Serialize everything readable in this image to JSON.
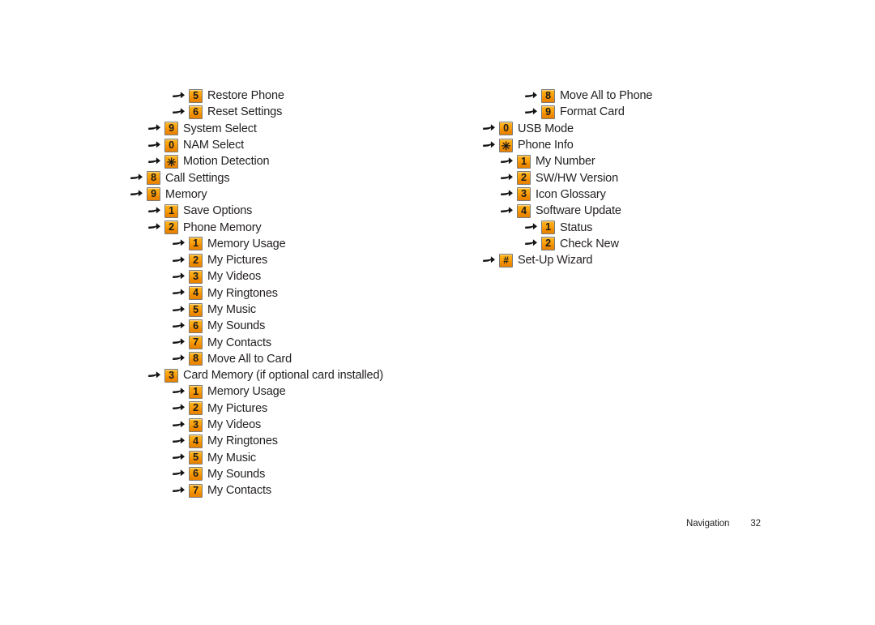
{
  "document": {
    "footer": {
      "section_label": "Navigation",
      "page_number": "32"
    }
  },
  "icons": {
    "arrow": "right-arrow-icon"
  },
  "colors": {
    "badge_top": "#ffb61e",
    "badge_bottom": "#e78200",
    "badge_border": "#7b7b7b",
    "text": "#231f20",
    "page_background": "#ffffff"
  },
  "menu": {
    "left_column": [
      {
        "level": 2,
        "key": "5",
        "label": "Restore Phone"
      },
      {
        "level": 2,
        "key": "6",
        "label": "Reset Settings"
      },
      {
        "level": 1,
        "key": "9",
        "label": "System Select"
      },
      {
        "level": 1,
        "key": "0",
        "label": "NAM Select"
      },
      {
        "level": 1,
        "key": "✳",
        "label": "Motion Detection"
      },
      {
        "level": 0,
        "key": "8",
        "label": "Call Settings"
      },
      {
        "level": 0,
        "key": "9",
        "label": "Memory"
      },
      {
        "level": 1,
        "key": "1",
        "label": "Save Options"
      },
      {
        "level": 1,
        "key": "2",
        "label": "Phone Memory"
      },
      {
        "level": 2,
        "key": "1",
        "label": "Memory Usage"
      },
      {
        "level": 2,
        "key": "2",
        "label": "My Pictures"
      },
      {
        "level": 2,
        "key": "3",
        "label": "My Videos"
      },
      {
        "level": 2,
        "key": "4",
        "label": "My Ringtones"
      },
      {
        "level": 2,
        "key": "5",
        "label": "My Music"
      },
      {
        "level": 2,
        "key": "6",
        "label": "My Sounds"
      },
      {
        "level": 2,
        "key": "7",
        "label": "My Contacts"
      },
      {
        "level": 2,
        "key": "8",
        "label": "Move All to Card"
      },
      {
        "level": 1,
        "key": "3",
        "label": "Card Memory (if optional card installed)"
      },
      {
        "level": 2,
        "key": "1",
        "label": "Memory Usage"
      },
      {
        "level": 2,
        "key": "2",
        "label": "My Pictures"
      },
      {
        "level": 2,
        "key": "3",
        "label": "My Videos"
      },
      {
        "level": 2,
        "key": "4",
        "label": "My Ringtones"
      },
      {
        "level": 2,
        "key": "5",
        "label": "My Music"
      },
      {
        "level": 2,
        "key": "6",
        "label": "My Sounds"
      },
      {
        "level": 2,
        "key": "7",
        "label": "My Contacts"
      }
    ],
    "right_column": [
      {
        "level": 2,
        "key": "8",
        "label": "Move All to Phone"
      },
      {
        "level": 2,
        "key": "9",
        "label": "Format Card"
      },
      {
        "level": 0,
        "key": "0",
        "label": "USB Mode"
      },
      {
        "level": 0,
        "key": "✳",
        "label": "Phone Info"
      },
      {
        "level": 1,
        "key": "1",
        "label": "My Number"
      },
      {
        "level": 1,
        "key": "2",
        "label": "SW/HW Version"
      },
      {
        "level": 1,
        "key": "3",
        "label": "Icon Glossary"
      },
      {
        "level": 1,
        "key": "4",
        "label": "Software Update"
      },
      {
        "level": 2,
        "key": "1",
        "label": "Status"
      },
      {
        "level": 2,
        "key": "2",
        "label": "Check New"
      },
      {
        "level": 0,
        "key": "#",
        "label": "Set-Up Wizard"
      }
    ]
  }
}
